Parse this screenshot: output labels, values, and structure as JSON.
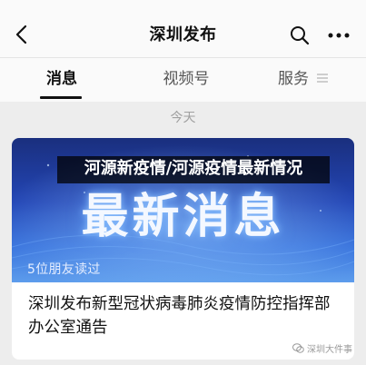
{
  "header": {
    "title": "深圳发布",
    "back_icon": "chevron-left-icon",
    "search_icon": "search-icon",
    "more_icon": "more-horizontal-icon"
  },
  "tabs": [
    {
      "label": "消息",
      "active": true
    },
    {
      "label": "视频号",
      "active": false
    },
    {
      "label": "服务",
      "active": false,
      "icon": "menu-lines-icon"
    }
  ],
  "date_label": "今天",
  "card": {
    "overlay_headline": "河源新疫情/河源疫情最新情况",
    "cover_text": "最新消息",
    "readers": "5位朋友读过",
    "title": "深圳发布新型冠状病毒肺炎疫情防控指挥部办公室通告"
  },
  "watermark": "深圳大件事",
  "colors": {
    "cover_dark": "#1a2f7e",
    "cover_light": "#5d9cec",
    "background": "#ededed"
  }
}
